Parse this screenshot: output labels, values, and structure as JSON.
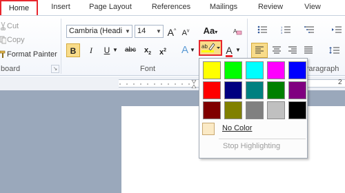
{
  "tabs": {
    "home": "Home",
    "insert": "Insert",
    "page_layout": "Page Layout",
    "references": "References",
    "mailings": "Mailings",
    "review": "Review",
    "view": "View"
  },
  "clipboard": {
    "cut": "Cut",
    "copy": "Copy",
    "format_painter": "Format Painter",
    "group_label": "board"
  },
  "font": {
    "family": "Cambria (Headi",
    "size": "14",
    "change_case_label": "Aa",
    "group_label": "Font"
  },
  "paragraph": {
    "group_label": "Paragraph"
  },
  "ruler": {
    "number": "2"
  },
  "highlight": {
    "colors": [
      "#ffff00",
      "#00ff00",
      "#00ffff",
      "#ff00ff",
      "#0000ff",
      "#ff0000",
      "#000080",
      "#008080",
      "#008000",
      "#800080",
      "#800000",
      "#808000",
      "#808080",
      "#c0c0c0",
      "#000000"
    ],
    "no_color": "No Color",
    "stop": "Stop Highlighting"
  }
}
